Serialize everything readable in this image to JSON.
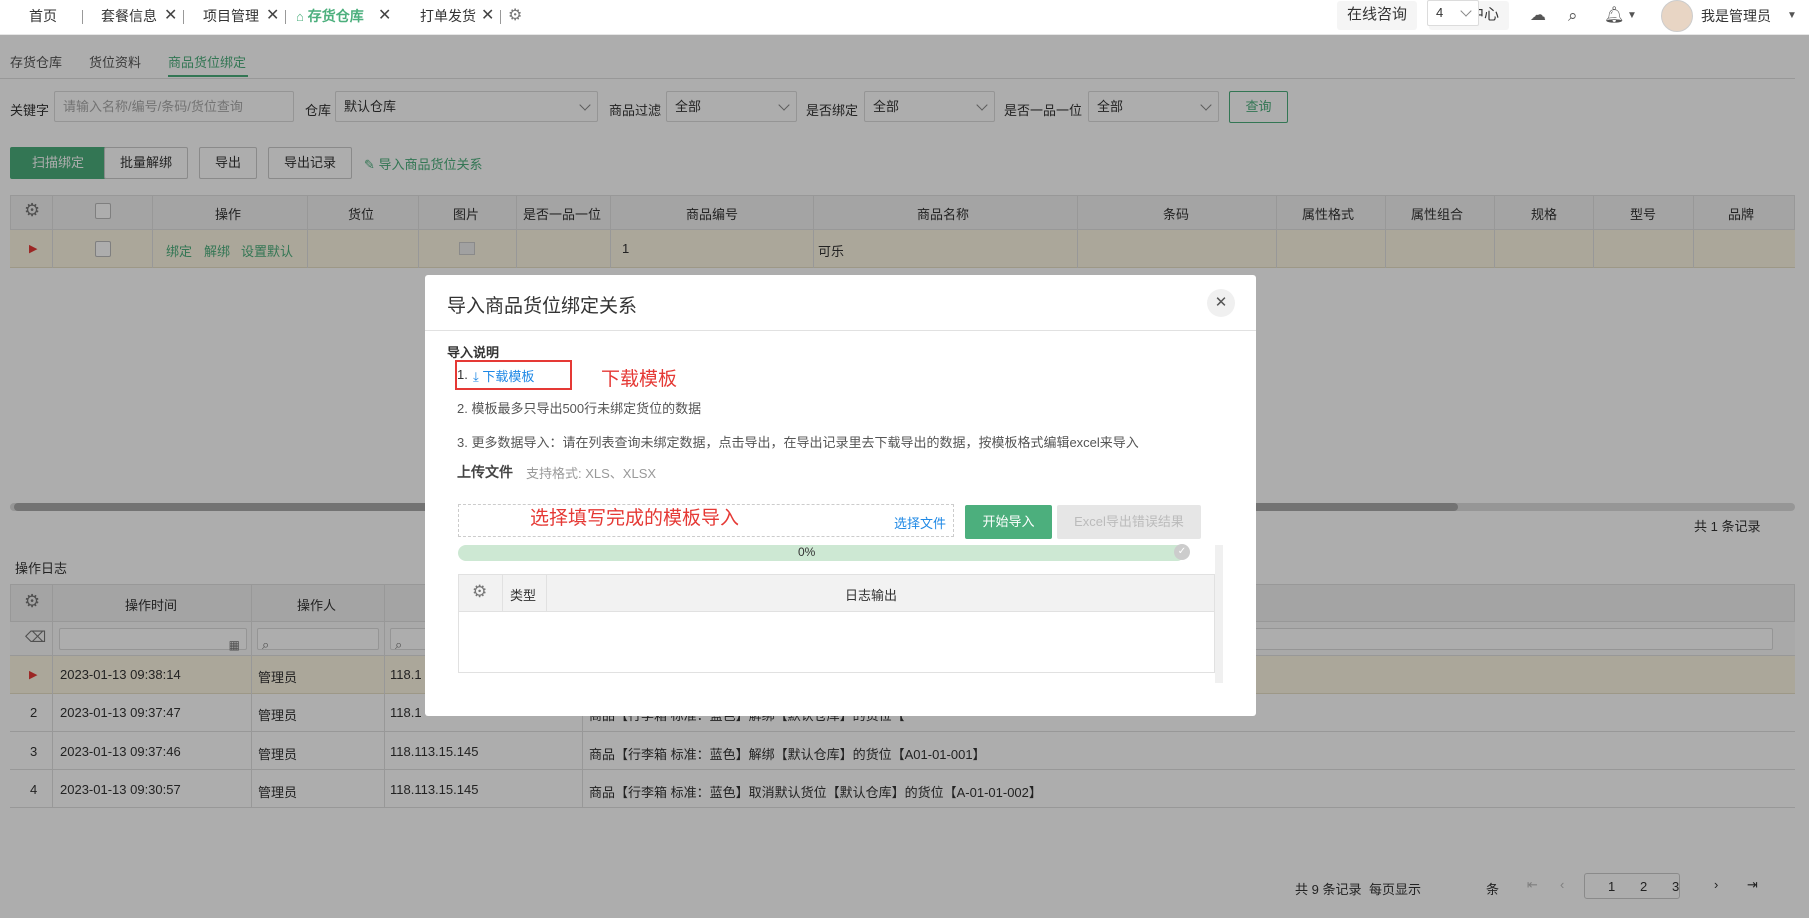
{
  "tabs": [
    {
      "label": "首页"
    },
    {
      "label": "套餐信息"
    },
    {
      "label": "项目管理"
    },
    {
      "label": "存货仓库"
    },
    {
      "label": "打单发货"
    }
  ],
  "topbar": {
    "online": "在线咨询",
    "service": "服务中心",
    "user": "我是管理员"
  },
  "subtabs": [
    "存货仓库",
    "货位资料",
    "商品货位绑定"
  ],
  "filters": {
    "keyword_label": "关键字",
    "keyword_placeholder": "请输入名称/编号/条码/货位查询",
    "warehouse_label": "仓库",
    "warehouse_value": "默认仓库",
    "goods_filter_label": "商品过滤",
    "goods_filter_value": "全部",
    "bound_label": "是否绑定",
    "bound_value": "全部",
    "one_item_label": "是否一品一位",
    "one_item_value": "全部",
    "query_button": "查询"
  },
  "toolbar": {
    "scan_bind": "扫描绑定",
    "batch_unbind": "批量解绑",
    "export": "导出",
    "export_records": "导出记录",
    "import_relation": "导入商品货位关系"
  },
  "main_table": {
    "columns": [
      "操作",
      "货位",
      "图片",
      "是否一品一位",
      "商品编号",
      "商品名称",
      "条码",
      "属性格式",
      "属性组合",
      "规格",
      "型号",
      "品牌"
    ],
    "rows": [
      {
        "actions": [
          "绑定",
          "解绑",
          "设置默认"
        ],
        "code": "1",
        "name": "可乐"
      }
    ],
    "total": "共 1 条记录"
  },
  "log": {
    "title": "操作日志",
    "columns": [
      "操作时间",
      "操作人"
    ],
    "rows": [
      {
        "index": "",
        "time": "2023-01-13 09:38:14",
        "operator": "管理员",
        "ip": "118.1",
        "content": ""
      },
      {
        "index": "2",
        "time": "2023-01-13 09:37:47",
        "operator": "管理员",
        "ip": "118.1",
        "content": "商品【行李箱 标准：蓝色】解绑【默认仓库】的货位【"
      },
      {
        "index": "3",
        "time": "2023-01-13 09:37:46",
        "operator": "管理员",
        "ip": "118.113.15.145",
        "content": "商品【行李箱 标准：蓝色】解绑【默认仓库】的货位【A01-01-001】"
      },
      {
        "index": "4",
        "time": "2023-01-13 09:30:57",
        "operator": "管理员",
        "ip": "118.113.15.145",
        "content": "商品【行李箱 标准：蓝色】取消默认货位【默认仓库】的货位【A-01-01-002】"
      }
    ],
    "pagination": {
      "total": "共 9 条记录",
      "per_page_label": "每页显示",
      "per_page": "4",
      "unit": "条",
      "pages": [
        "1",
        "2",
        "3"
      ]
    }
  },
  "modal": {
    "title": "导入商品货位绑定关系",
    "instructions_heading": "导入说明",
    "step1_prefix": "1.",
    "download_template": "下载模板",
    "annotation_download": "下载模板",
    "step2": "2. 模板最多只导出500行未绑定货位的数据",
    "step3": "3. 更多数据导入：请在列表查询未绑定数据，点击导出，在导出记录里去下载导出的数据，按模板格式编辑excel来导入",
    "upload_label": "上传文件",
    "upload_formats": "支持格式: XLS、XLSX",
    "annotation_select": "选择填写完成的模板导入",
    "select_file": "选择文件",
    "start_import": "开始导入",
    "export_errors": "Excel导出错误结果",
    "progress": 0,
    "progress_text": "0%",
    "log_columns": {
      "type": "类型",
      "output": "日志输出"
    }
  },
  "colors": {
    "accent": "#4caf7d",
    "annotation": "#e53935",
    "link": "#1e88e5"
  }
}
